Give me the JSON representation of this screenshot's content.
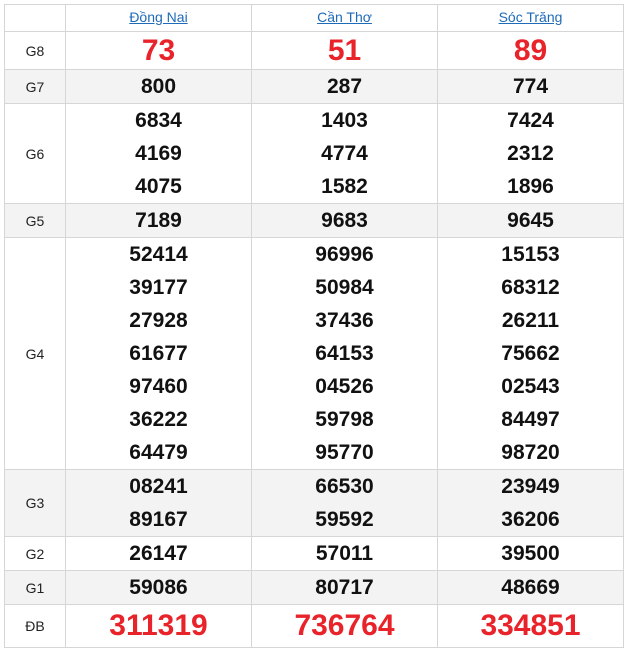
{
  "provinces": [
    "Đồng Nai",
    "Cần Thơ",
    "Sóc Trăng"
  ],
  "prizes": [
    {
      "label": "G8",
      "style": "big",
      "values": [
        [
          "73"
        ],
        [
          "51"
        ],
        [
          "89"
        ]
      ]
    },
    {
      "label": "G7",
      "style": "alt",
      "values": [
        [
          "800"
        ],
        [
          "287"
        ],
        [
          "774"
        ]
      ]
    },
    {
      "label": "G6",
      "style": "",
      "values": [
        [
          "6834",
          "4169",
          "4075"
        ],
        [
          "1403",
          "4774",
          "1582"
        ],
        [
          "7424",
          "2312",
          "1896"
        ]
      ]
    },
    {
      "label": "G5",
      "style": "alt",
      "values": [
        [
          "7189"
        ],
        [
          "9683"
        ],
        [
          "9645"
        ]
      ]
    },
    {
      "label": "G4",
      "style": "",
      "values": [
        [
          "52414",
          "39177",
          "27928",
          "61677",
          "97460",
          "36222",
          "64479"
        ],
        [
          "96996",
          "50984",
          "37436",
          "64153",
          "04526",
          "59798",
          "95770"
        ],
        [
          "15153",
          "68312",
          "26211",
          "75662",
          "02543",
          "84497",
          "98720"
        ]
      ]
    },
    {
      "label": "G3",
      "style": "alt",
      "values": [
        [
          "08241",
          "89167"
        ],
        [
          "66530",
          "59592"
        ],
        [
          "23949",
          "36206"
        ]
      ]
    },
    {
      "label": "G2",
      "style": "",
      "values": [
        [
          "26147"
        ],
        [
          "57011"
        ],
        [
          "39500"
        ]
      ]
    },
    {
      "label": "G1",
      "style": "alt",
      "values": [
        [
          "59086"
        ],
        [
          "80717"
        ],
        [
          "48669"
        ]
      ]
    },
    {
      "label": "ĐB",
      "style": "big",
      "values": [
        [
          "311319"
        ],
        [
          "736764"
        ],
        [
          "334851"
        ]
      ]
    }
  ],
  "colors": {
    "accent_red": "#e8232a",
    "link_blue": "#1e6bb8",
    "alt_row": "#f3f3f3"
  }
}
